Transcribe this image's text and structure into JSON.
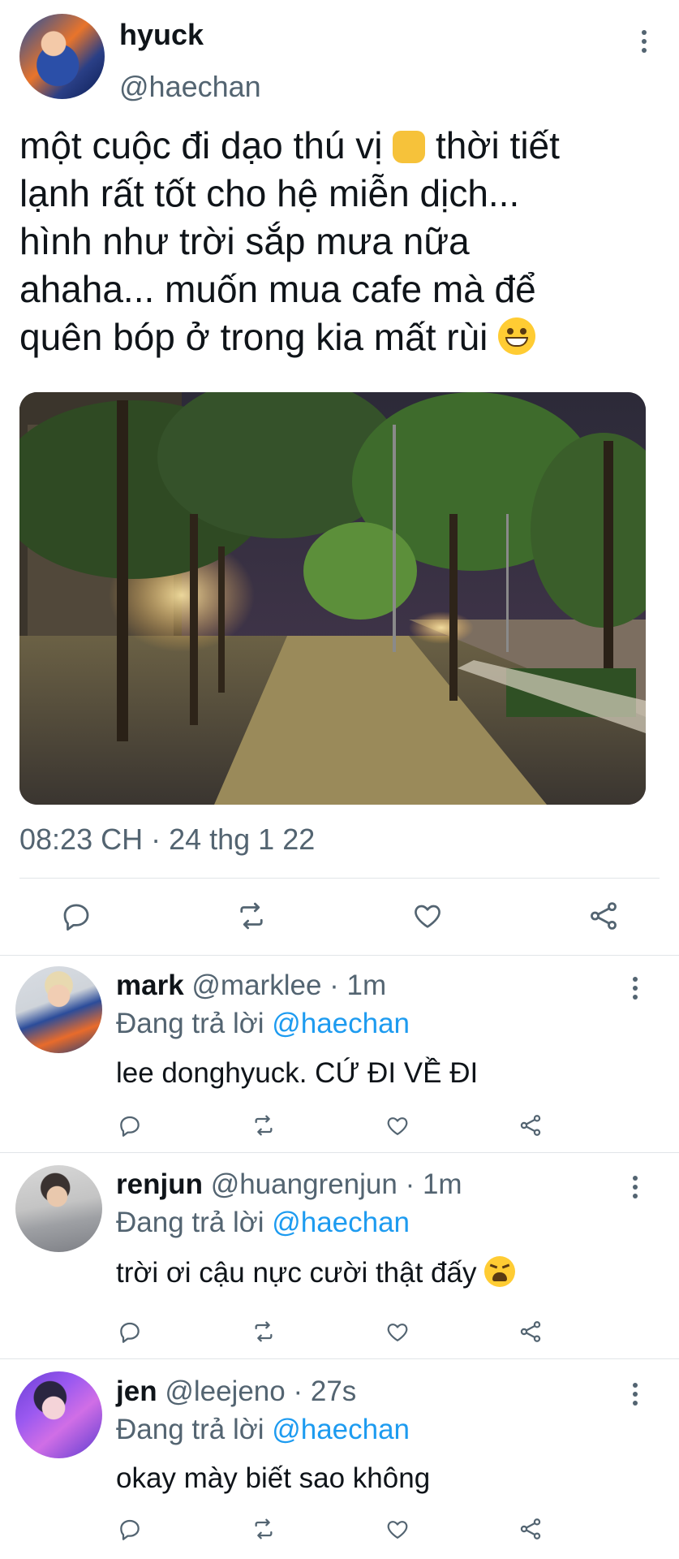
{
  "tweet": {
    "name": "hyuck",
    "handle": "@haechan",
    "text_lines": [
      "một cuộc đi dạo thú vị",
      "thời tiết",
      "lạnh rất tốt cho hệ miễn dịch...",
      "hình như trời sắp mưa nữa",
      "ahaha... muốn mua cafe mà để",
      "quên bóp ở trong kia mất rùi"
    ],
    "emojis": [
      "thumbs-up",
      "grinning-face"
    ],
    "timestamp": "08:23 CH · 24 thg 1 22"
  },
  "replies": [
    {
      "name": "mark",
      "handle": "@marklee",
      "time": "· 1m",
      "replying_prefix": "Đang trả lời",
      "replying_to": "@haechan",
      "text": "lee donghyuck. CỨ ĐI VỀ ĐI"
    },
    {
      "name": "renjun",
      "handle": "@huangrenjun",
      "time": "· 1m",
      "replying_prefix": "Đang trả lời",
      "replying_to": "@haechan",
      "text": "trời ơi cậu nực cười thật đấy",
      "emoji": "weary-face"
    },
    {
      "name": "jen",
      "handle": "@leejeno",
      "time": "· 27s",
      "replying_prefix": "Đang trả lời",
      "replying_to": "@haechan",
      "text": "okay mày biết sao không"
    }
  ],
  "colors": {
    "text": "#0f1419",
    "secondary": "#536471",
    "link": "#1d9bf0",
    "divider": "#e1e5e8"
  },
  "icons": [
    "more-icon",
    "reply-icon",
    "retweet-icon",
    "like-icon",
    "share-icon"
  ]
}
